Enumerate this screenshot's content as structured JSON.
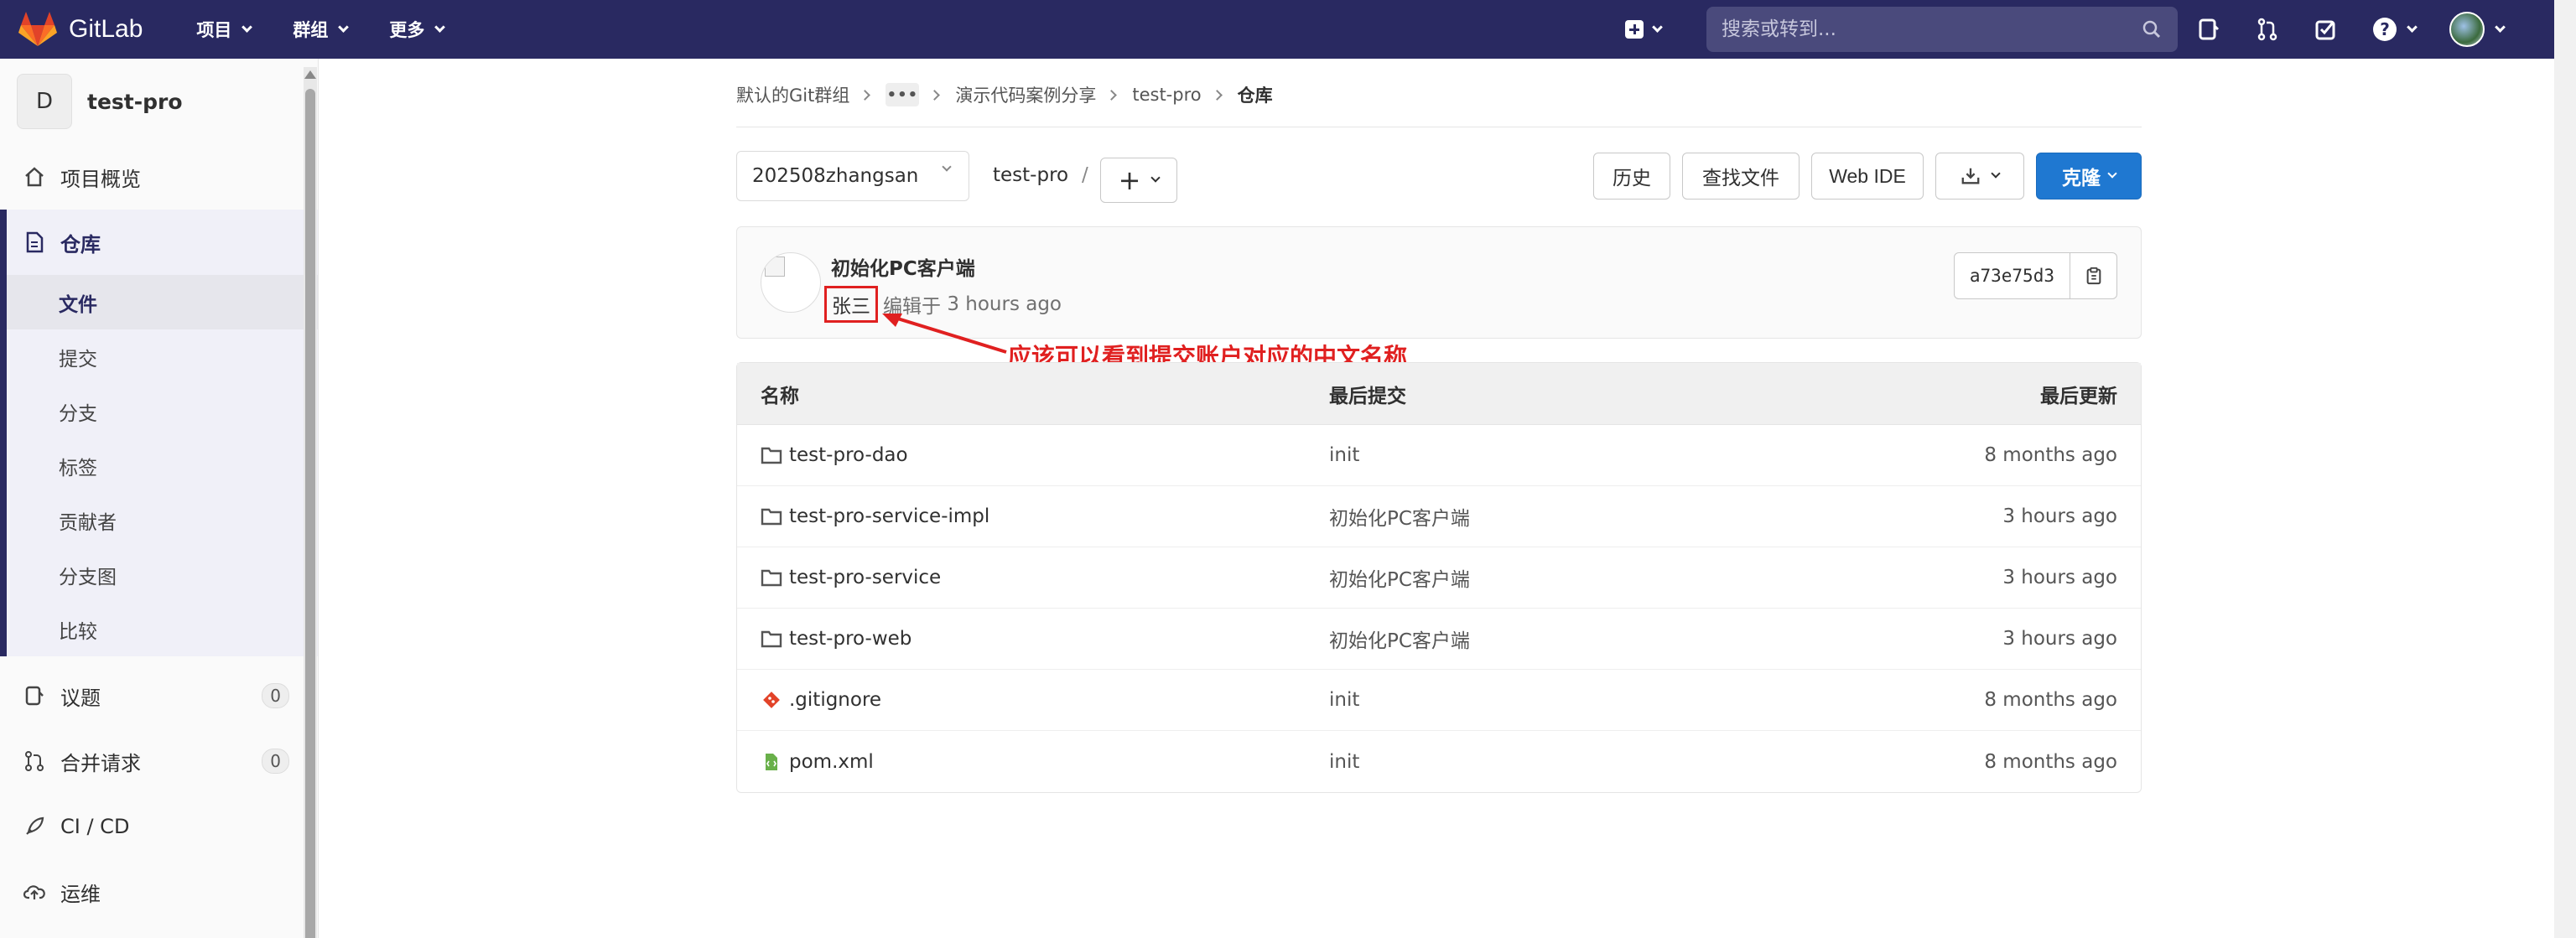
{
  "navbar": {
    "brand": "GitLab",
    "menu": [
      "项目",
      "群组",
      "更多"
    ],
    "search_placeholder": "搜索或转到...",
    "bg_color": "#292961"
  },
  "sidebar": {
    "project_initial": "D",
    "project_name": "test-pro",
    "overview": "项目概览",
    "repository": "仓库",
    "repo_items": [
      "文件",
      "提交",
      "分支",
      "标签",
      "贡献者",
      "分支图",
      "比较"
    ],
    "issues": "议题",
    "issues_count": "0",
    "merge_requests": "合并请求",
    "merge_requests_count": "0",
    "cicd": "CI / CD",
    "operations": "运维"
  },
  "breadcrumb": {
    "items": [
      "默认的Git群组",
      "演示代码案例分享",
      "test-pro"
    ],
    "ellipsis": "•••",
    "current": "仓库"
  },
  "toolbar": {
    "branch": "202508zhangsan",
    "path": "test-pro",
    "slash": "/",
    "add": "+",
    "history": "历史",
    "find_file": "查找文件",
    "web_ide": "Web IDE",
    "clone": "克隆"
  },
  "commit": {
    "title": "初始化PC客户端",
    "author": "张三",
    "edited_prefix": "编辑于",
    "edited_time": "3 hours ago",
    "sha": "a73e75d3"
  },
  "annotation": "应该可以看到提交账户对应的中文名称",
  "table": {
    "headers": {
      "name": "名称",
      "last_commit": "最后提交",
      "last_update": "最后更新"
    },
    "rows": [
      {
        "icon": "folder-icon",
        "name": "test-pro-dao",
        "commit": "init",
        "date": "8 months ago"
      },
      {
        "icon": "folder-icon",
        "name": "test-pro-service-impl",
        "commit": "初始化PC客户端",
        "date": "3 hours ago"
      },
      {
        "icon": "folder-icon",
        "name": "test-pro-service",
        "commit": "初始化PC客户端",
        "date": "3 hours ago"
      },
      {
        "icon": "folder-icon",
        "name": "test-pro-web",
        "commit": "初始化PC客户端",
        "date": "3 hours ago"
      },
      {
        "icon": "git-file-icon",
        "name": ".gitignore",
        "commit": "init",
        "date": "8 months ago"
      },
      {
        "icon": "xml-file-icon",
        "name": "pom.xml",
        "commit": "init",
        "date": "8 months ago"
      }
    ]
  },
  "colors": {
    "accent": "#1f78d1",
    "annotation": "#e02020"
  }
}
